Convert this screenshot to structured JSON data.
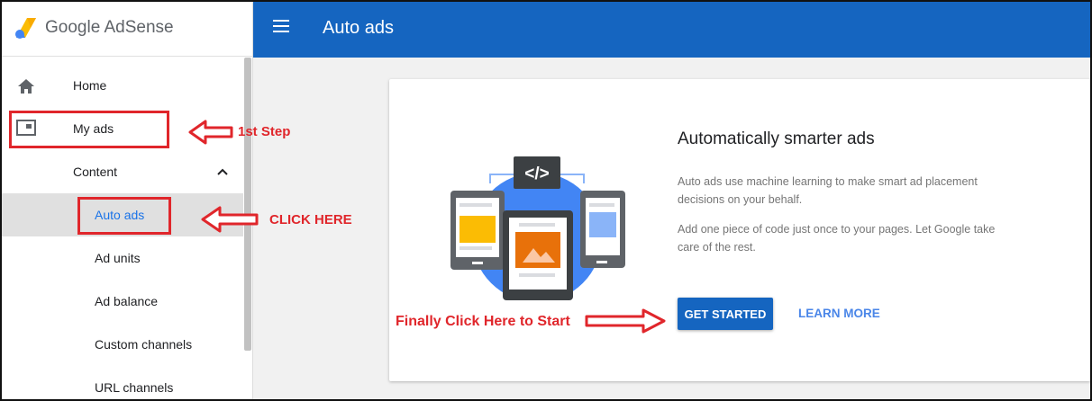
{
  "app": {
    "brand": "Google AdSense"
  },
  "header": {
    "title": "Auto ads"
  },
  "sidebar": {
    "items": [
      {
        "label": "Home"
      },
      {
        "label": "My ads"
      },
      {
        "label": "Content"
      },
      {
        "label": "Auto ads"
      },
      {
        "label": "Ad units"
      },
      {
        "label": "Ad balance"
      },
      {
        "label": "Custom channels"
      },
      {
        "label": "URL channels"
      }
    ]
  },
  "card": {
    "heading": "Automatically smarter ads",
    "paragraph1": "Auto ads use machine learning to make smart ad placement decisions on your behalf.",
    "paragraph2": "Add one piece of code just once to your pages. Let Google take care of the rest.",
    "primary_button": "GET STARTED",
    "secondary_link": "LEARN MORE",
    "illustration_code": "</>"
  },
  "annotations": {
    "step1": "1st Step",
    "click_here": "CLICK HERE",
    "finally": "Finally Click Here to Start",
    "color": "#e0262b"
  },
  "colors": {
    "topbar": "#1565c0",
    "accent": "#1a73e8"
  }
}
